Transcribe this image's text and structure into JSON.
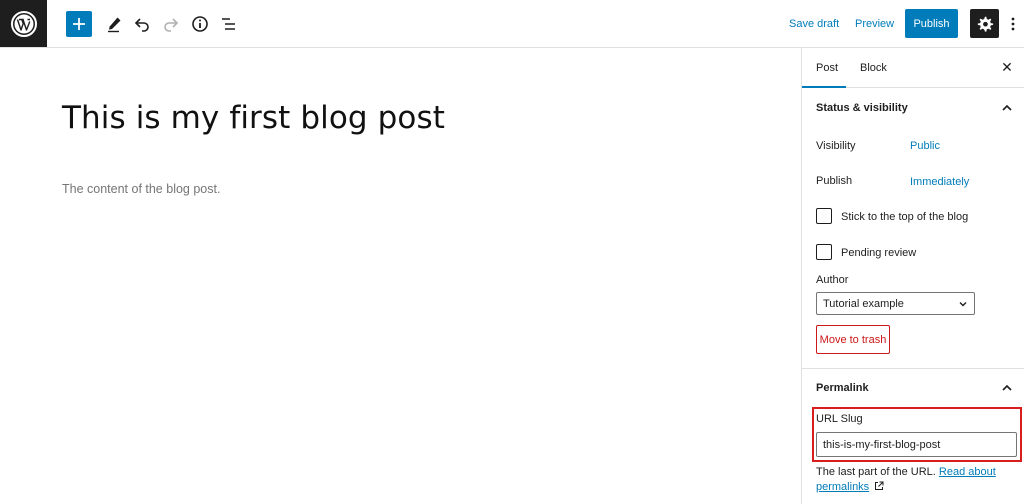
{
  "toolbar": {
    "save_draft_label": "Save draft",
    "preview_label": "Preview",
    "publish_label": "Publish",
    "icons": [
      "wordpress-logo-icon",
      "plus-icon",
      "pencil-icon",
      "undo-icon",
      "redo-icon",
      "info-icon",
      "list-view-icon",
      "gear-icon",
      "more-vertical-icon"
    ],
    "accent_color": "#007cba"
  },
  "editor": {
    "title": "This is my first blog post",
    "content": "The content of the blog post."
  },
  "sidebar": {
    "tabs": [
      {
        "label": "Post",
        "active": true
      },
      {
        "label": "Block",
        "active": false
      }
    ],
    "close_symbol": "✕",
    "status_panel": {
      "title": "Status & visibility",
      "visibility_label": "Visibility",
      "visibility_value": "Public",
      "publish_label": "Publish",
      "publish_value": "Immediately",
      "stick_to_top_label": "Stick to the top of the blog",
      "pending_review_label": "Pending review",
      "author_label": "Author",
      "author_value": "Tutorial example",
      "trash_label": "Move to trash"
    },
    "permalink_panel": {
      "title": "Permalink",
      "slug_label": "URL Slug",
      "slug_value": "this-is-my-first-blog-post",
      "help_text": "The last part of the URL.",
      "help_link_part1": "Read about",
      "help_link_part2": "permalinks"
    },
    "highlight_color": "#d91c1c",
    "danger_color": "#cc1818"
  }
}
